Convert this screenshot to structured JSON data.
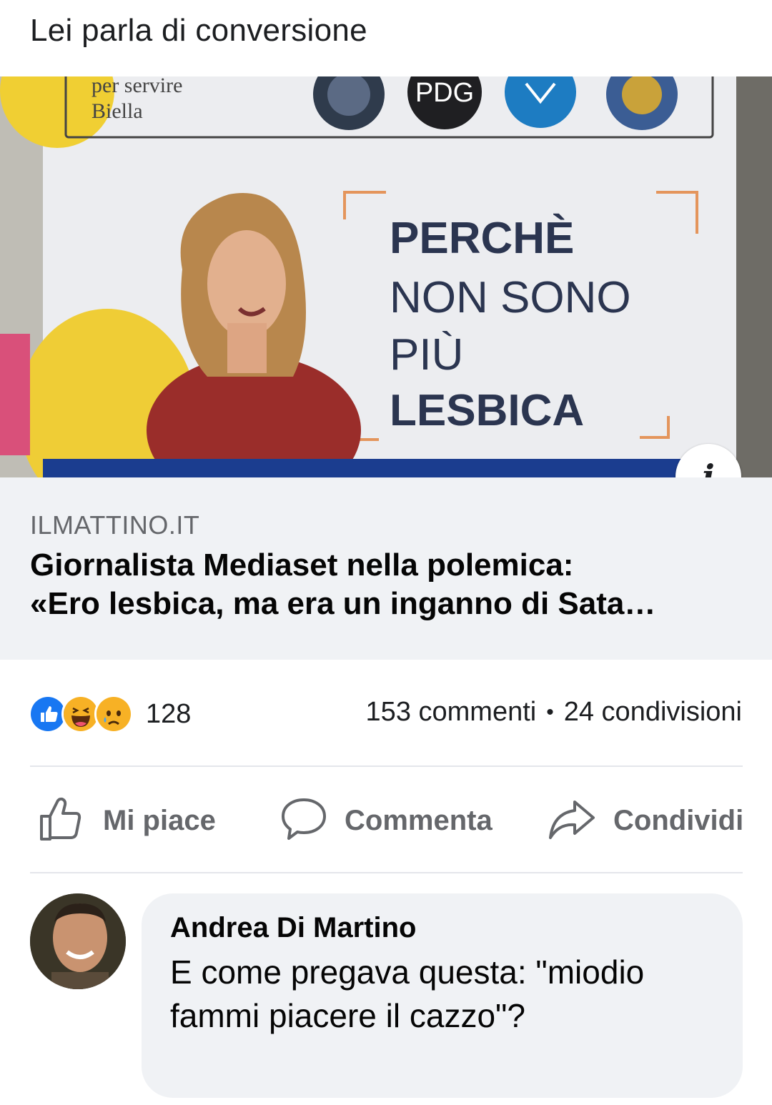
{
  "post": {
    "text": "Lei parla di conversione"
  },
  "image": {
    "poster_top_text": "per servire",
    "poster_top_text2": "Biella",
    "poster_logo_label": "PDG",
    "poster_line1": "PERCHÈ",
    "poster_line2": "NON SONO",
    "poster_line3": "PIÙ",
    "poster_line4": "LESBICA"
  },
  "link": {
    "domain": "ILMATTINO.IT",
    "title_line1": "Giornalista Mediaset nella polemica:",
    "title_line2": "«Ero lesbica, ma era un inganno di Sata…",
    "info_icon": "i"
  },
  "stats": {
    "reaction_icons": [
      "like-icon",
      "haha-icon",
      "sad-icon"
    ],
    "reaction_count": "128",
    "comments": "153 commenti",
    "separator": "•",
    "shares": "24 condivisioni"
  },
  "actions": {
    "like_label": "Mi piace",
    "comment_label": "Commenta",
    "share_label": "Condividi"
  },
  "comment": {
    "author": "Andrea Di Martino",
    "text": "E come pregava questa: \"miodio fammi piacere il cazzo\"?"
  },
  "colors": {
    "like_blue": "#1877f2",
    "haha_yellow": "#f7b125",
    "secondary_text": "#65676b",
    "bubble_bg": "#f0f2f5"
  }
}
